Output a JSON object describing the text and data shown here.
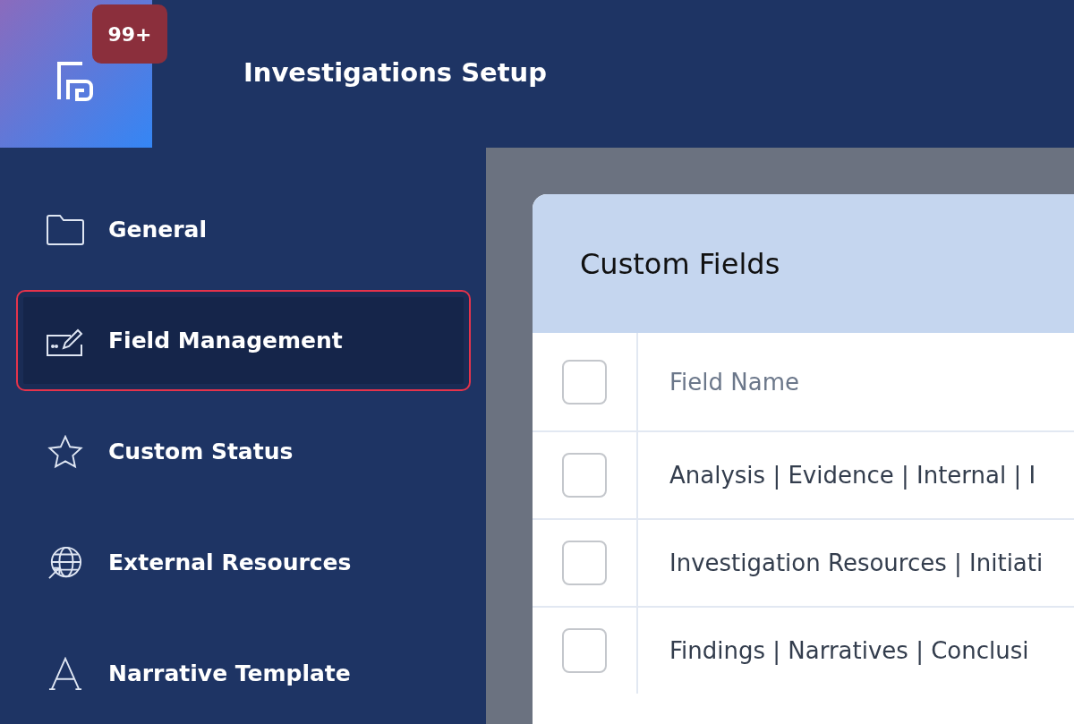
{
  "header": {
    "badge": "99+",
    "title": "Investigations Setup"
  },
  "sidebar": {
    "items": [
      {
        "label": "General",
        "kind": "folder",
        "selected": false
      },
      {
        "label": "Field Management",
        "kind": "edit",
        "selected": true
      },
      {
        "label": "Custom Status",
        "kind": "star",
        "selected": false
      },
      {
        "label": "External Resources",
        "kind": "globe",
        "selected": false
      },
      {
        "label": "Narrative Template",
        "kind": "letter",
        "selected": false
      }
    ]
  },
  "card": {
    "title": "Custom Fields",
    "table": {
      "header": {
        "checked": false,
        "label": "Field Name"
      },
      "rows": [
        {
          "checked": false,
          "field_name": "Analysis | Evidence | Internal | I"
        },
        {
          "checked": false,
          "field_name": "Investigation Resources | Initiati"
        },
        {
          "checked": false,
          "field_name": "Findings | Narratives | Conclusi"
        }
      ]
    }
  }
}
